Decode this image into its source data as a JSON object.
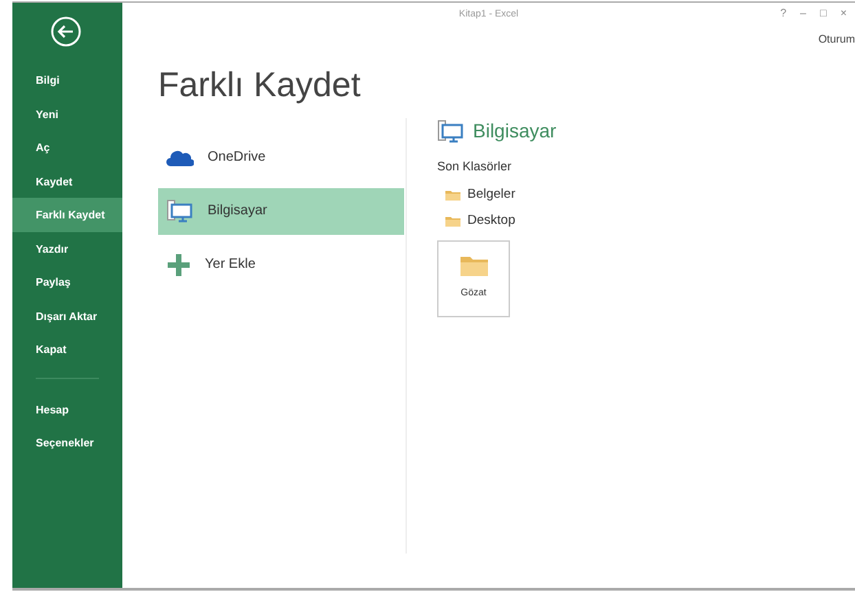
{
  "window": {
    "title": "Kitap1 - Excel",
    "controls": [
      "?",
      "–",
      "□",
      "×"
    ],
    "account": "Oturum"
  },
  "sidebar": {
    "sections": [
      {
        "items": [
          {
            "label": "Bilgi",
            "selected": false
          },
          {
            "label": "Yeni",
            "selected": false
          },
          {
            "label": "Aç",
            "selected": false
          },
          {
            "label": "Kaydet",
            "selected": false
          },
          {
            "label": "Farklı Kaydet",
            "selected": true
          },
          {
            "label": "Yazdır",
            "selected": false
          },
          {
            "label": "Paylaş",
            "selected": false
          },
          {
            "label": "Dışarı Aktar",
            "selected": false
          },
          {
            "label": "Kapat",
            "selected": false
          }
        ]
      },
      {
        "items": [
          {
            "label": "Hesap",
            "selected": false
          },
          {
            "label": "Seçenekler",
            "selected": false
          }
        ]
      }
    ]
  },
  "page_title": "Farklı Kaydet",
  "places": [
    {
      "label": "OneDrive",
      "kind": "cloud",
      "selected": false
    },
    {
      "label": "Bilgisayar",
      "kind": "computer",
      "selected": true
    },
    {
      "label": "Yer Ekle",
      "kind": "add",
      "selected": false
    }
  ],
  "detail": {
    "heading": "Bilgisayar",
    "recent_heading": "Son Klasörler",
    "folders": [
      "Belgeler",
      "Desktop"
    ],
    "browse": "Gözat"
  }
}
